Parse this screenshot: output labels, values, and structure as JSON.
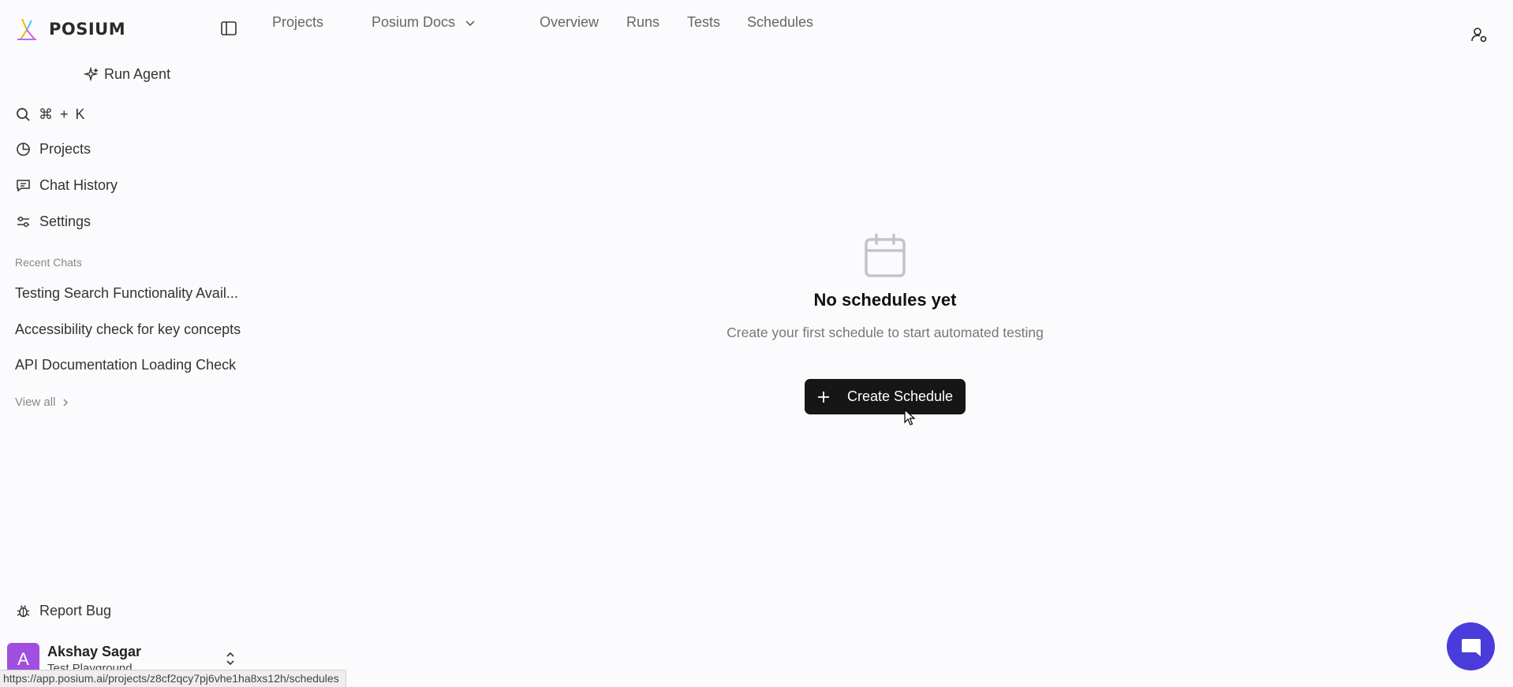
{
  "brand": {
    "name": "POSIUM",
    "logo_icon": "posium-logo"
  },
  "topnav": {
    "projects": "Projects",
    "workspace": "Posium Docs",
    "overview": "Overview",
    "runs": "Runs",
    "tests": "Tests",
    "schedules": "Schedules"
  },
  "sidebar": {
    "run_agent": "Run Agent",
    "search_shortcut": "⌘ + K",
    "items": [
      {
        "label": "Projects",
        "icon": "pie-chart-icon"
      },
      {
        "label": "Chat History",
        "icon": "message-icon"
      },
      {
        "label": "Settings",
        "icon": "sliders-icon"
      }
    ],
    "recent_label": "Recent Chats",
    "recent_chats": [
      "Testing Search Functionality Avail...",
      "Accessibility check for key concepts",
      "API Documentation Loading Check"
    ],
    "view_all": "View all",
    "report_bug": "Report Bug"
  },
  "account": {
    "initial": "A",
    "name": "Akshay Sagar",
    "org": "Test Playground",
    "avatar_color": "#a14fe0"
  },
  "empty_state": {
    "title": "No schedules yet",
    "description": "Create your first schedule to start automated testing",
    "button": "Create Schedule"
  },
  "status_url": "https://app.posium.ai/projects/z8cf2qcy7pj6vhe1ha8xs12h/schedules",
  "colors": {
    "primary_button": "#161616",
    "chat_bubble": "#4a3cdb",
    "background": "#fbfbfd"
  }
}
